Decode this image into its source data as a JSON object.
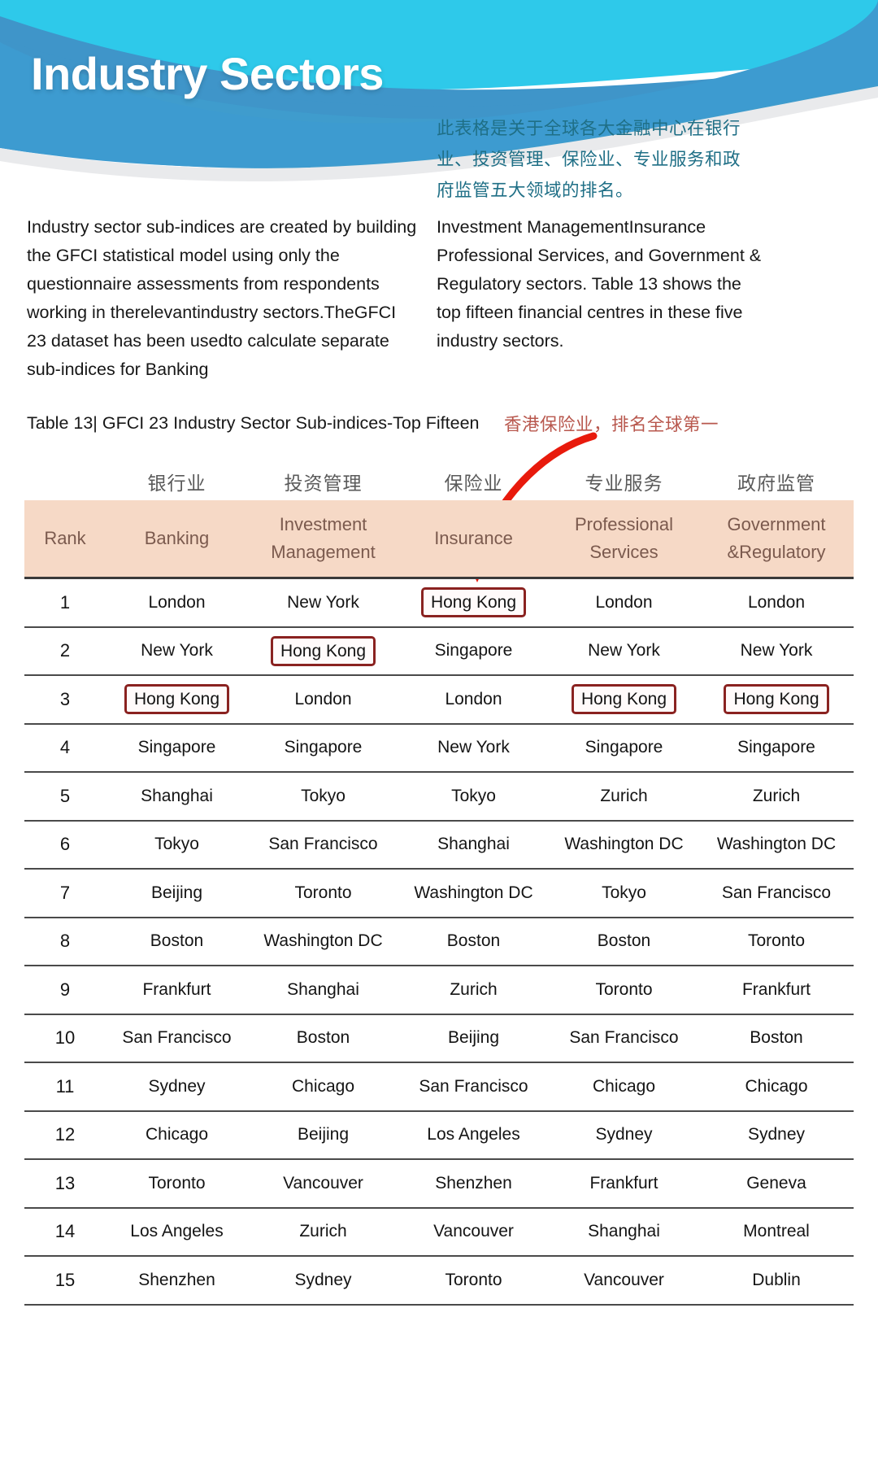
{
  "banner": {
    "title": "Industry Sectors",
    "colors": {
      "dark_navy": "#134a7c",
      "mid_blue": "#1b6fb5",
      "cyan": "#2ec7e8",
      "steel_blue": "#3f9ccd",
      "body_blue": "#3d9bd0"
    }
  },
  "cn_intro": "此表格是关于全球各大金融中心在银行业、投资管理、保险业、专业服务和政府监管五大领域的排名。",
  "body_left": "Industry sector sub-indices are created by building the GFCI statistical model using only the questionnaire assessments from respondents working in therelevantindustry sectors.TheGFCI 23 dataset has been usedto calculate separate sub-indices for Banking",
  "body_right": "Investment ManagementInsurance Professional Services, and Government & Regulatory sectors. Table 13 shows the top fifteen financial centres in these five industry sectors.",
  "table_caption": "Table 13| GFCI 23 Industry Sector Sub-indices-Top Fifteen",
  "cn_annotation": "香港保险业，排名全球第一",
  "annotation_color": "#b8574d",
  "arrow": {
    "name": "red-curved-arrow",
    "color": "#e81a0c",
    "points_to": "Hong Kong in Insurance column, rank 1"
  },
  "table": {
    "cn_column_labels": [
      "银行业",
      "投资管理",
      "保险业",
      "专业服务",
      "政府监管"
    ],
    "header_bg": "#f6d9c6",
    "header_text_color": "#7b5a4e",
    "columns": [
      "Rank",
      "Banking",
      "Investment Management",
      "Insurance",
      "Professional Services",
      "Government &Regulatory"
    ],
    "columns_wrapped": [
      [
        "Rank"
      ],
      [
        "Banking"
      ],
      [
        "Investment",
        "Management"
      ],
      [
        "Insurance"
      ],
      [
        "Professional",
        "Services"
      ],
      [
        "Government",
        "&Regulatory"
      ]
    ],
    "highlight": {
      "value": "Hong Kong",
      "border_color": "#8a2220",
      "cells": [
        {
          "rank": 1,
          "col": 3
        },
        {
          "rank": 2,
          "col": 2
        },
        {
          "rank": 3,
          "col": 1
        },
        {
          "rank": 3,
          "col": 4
        },
        {
          "rank": 3,
          "col": 5
        }
      ]
    },
    "rows": [
      [
        "1",
        "London",
        "New York",
        "Hong Kong",
        "London",
        "London"
      ],
      [
        "2",
        "New York",
        "Hong Kong",
        "Singapore",
        "New York",
        "New York"
      ],
      [
        "3",
        "Hong Kong",
        "London",
        "London",
        "Hong Kong",
        "Hong Kong"
      ],
      [
        "4",
        "Singapore",
        "Singapore",
        "New York",
        "Singapore",
        "Singapore"
      ],
      [
        "5",
        "Shanghai",
        "Tokyo",
        "Tokyo",
        "Zurich",
        "Zurich"
      ],
      [
        "6",
        "Tokyo",
        "San Francisco",
        "Shanghai",
        "Washington DC",
        "Washington DC"
      ],
      [
        "7",
        "Beijing",
        "Toronto",
        "Washington DC",
        "Tokyo",
        "San Francisco"
      ],
      [
        "8",
        "Boston",
        "Washington DC",
        "Boston",
        "Boston",
        "Toronto"
      ],
      [
        "9",
        "Frankfurt",
        "Shanghai",
        "Zurich",
        "Toronto",
        "Frankfurt"
      ],
      [
        "10",
        "San Francisco",
        "Boston",
        "Beijing",
        "San Francisco",
        "Boston"
      ],
      [
        "11",
        "Sydney",
        "Chicago",
        "San Francisco",
        "Chicago",
        "Chicago"
      ],
      [
        "12",
        "Chicago",
        "Beijing",
        "Los Angeles",
        "Sydney",
        "Sydney"
      ],
      [
        "13",
        "Toronto",
        "Vancouver",
        "Shenzhen",
        "Frankfurt",
        "Geneva"
      ],
      [
        "14",
        "Los Angeles",
        "Zurich",
        "Vancouver",
        "Shanghai",
        "Montreal"
      ],
      [
        "15",
        "Shenzhen",
        "Sydney",
        "Toronto",
        "Vancouver",
        "Dublin"
      ]
    ]
  }
}
